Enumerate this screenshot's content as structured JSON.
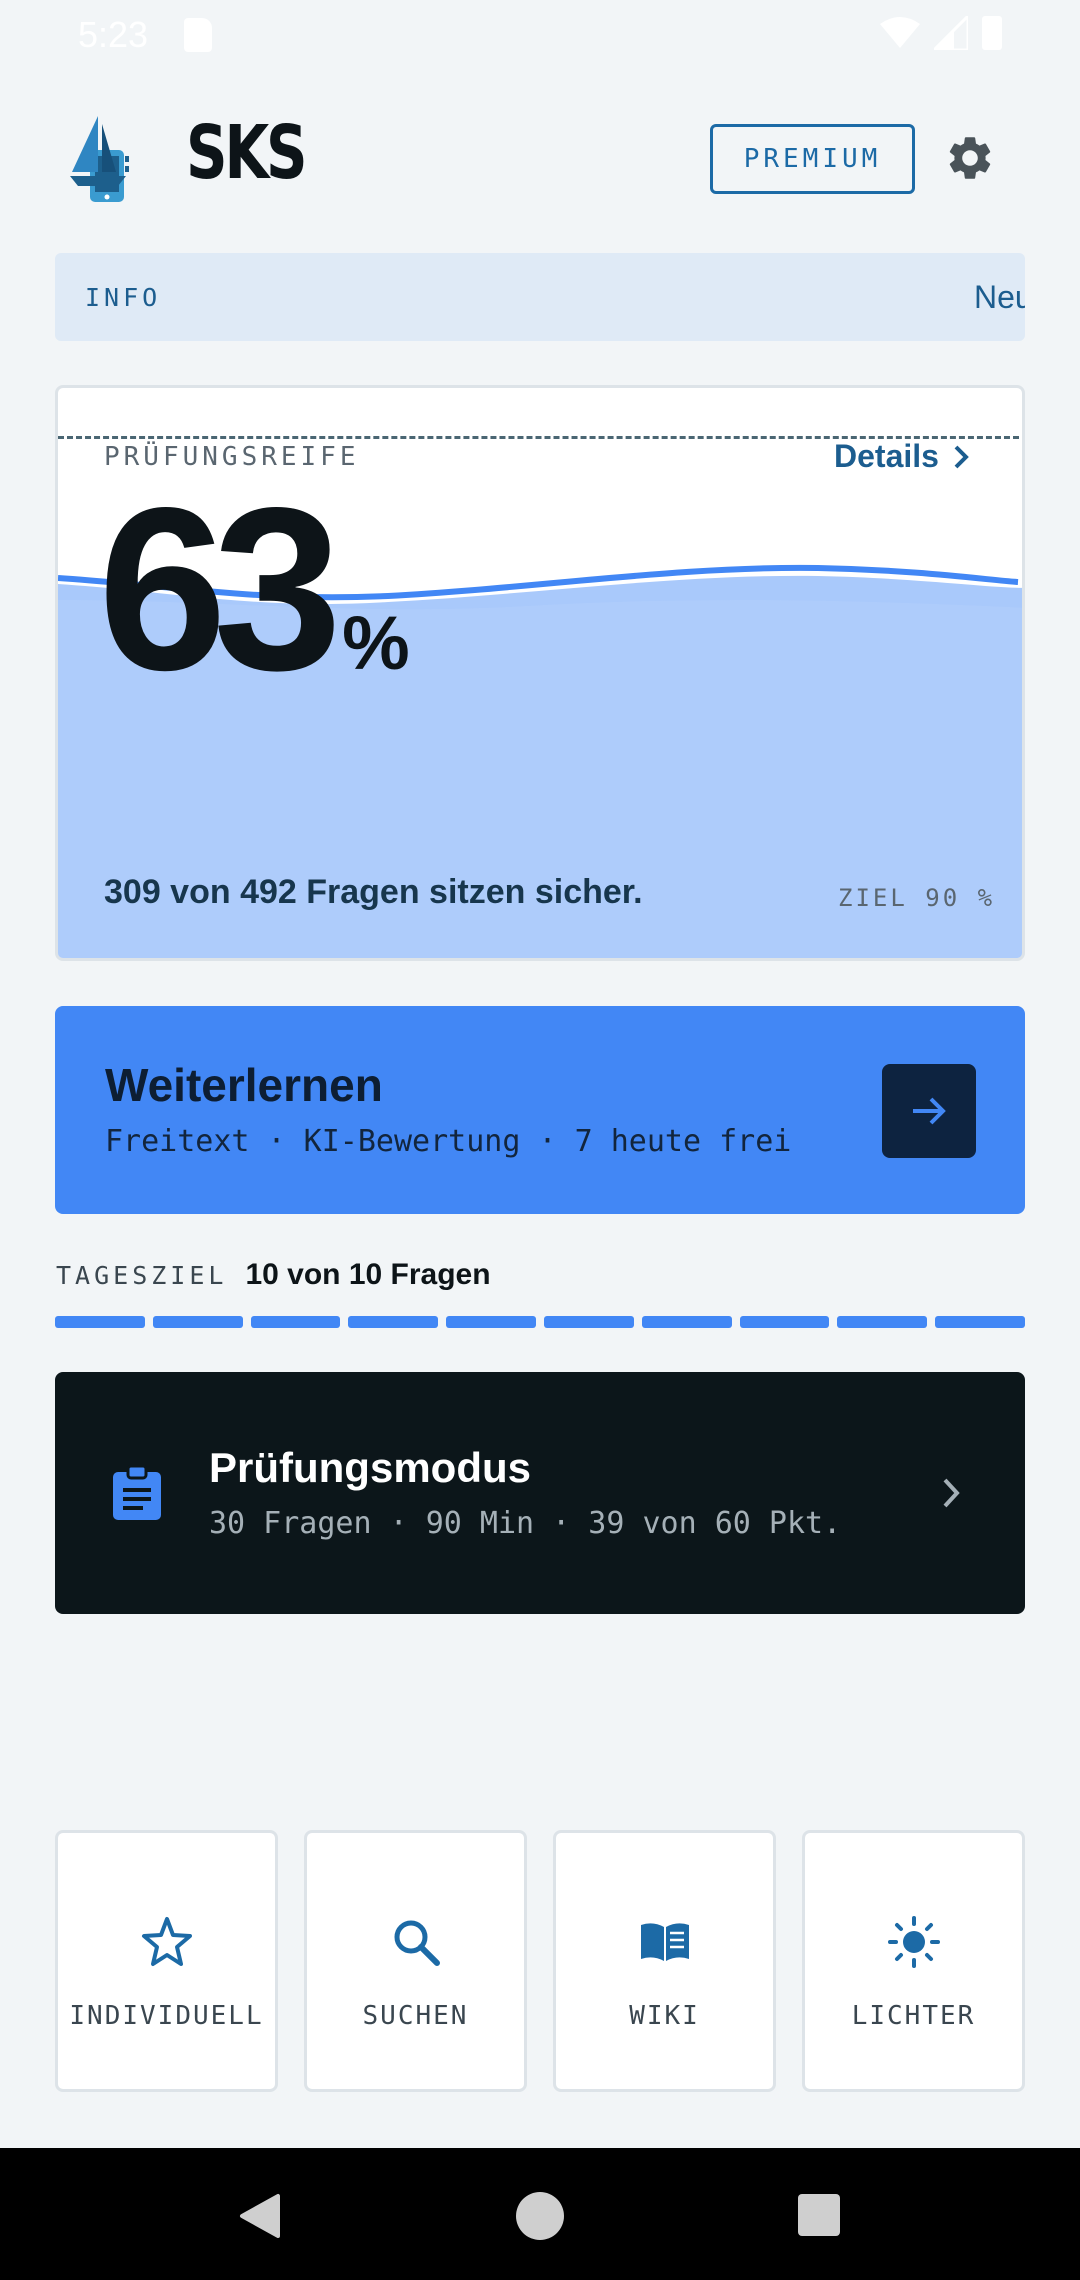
{
  "status_bar": {
    "time": "5:23"
  },
  "header": {
    "title": "SKS",
    "premium_label": "PREMIUM"
  },
  "info": {
    "label": "INFO",
    "ticker": "Neu"
  },
  "readiness": {
    "label": "PRÜFUNGSREIFE",
    "details_label": "Details",
    "percent_value": "63",
    "percent_sign": "%",
    "known_text": "309 von 492 Fragen sitzen sicher.",
    "goal_text": "ZIEL 90 %"
  },
  "continue": {
    "title": "Weiterlernen",
    "subtitle": "Freitext · KI-Bewertung · 7 heute frei"
  },
  "daily_goal": {
    "label": "TAGESZIEL",
    "value": "10 von 10 Fragen",
    "done": 10,
    "total": 10
  },
  "exam": {
    "title": "Prüfungsmodus",
    "subtitle": "30 Fragen · 90 Min · 39 von 60 Pkt."
  },
  "tiles": [
    {
      "label": "INDIVIDUELL",
      "icon": "star-icon"
    },
    {
      "label": "SUCHEN",
      "icon": "search-icon"
    },
    {
      "label": "WIKI",
      "icon": "book-icon"
    },
    {
      "label": "LICHTER",
      "icon": "sun-icon"
    }
  ],
  "colors": {
    "accent": "#4287f5",
    "brand_blue": "#1c6aa6",
    "dark_card": "#0c161a",
    "wave_fill": "#a9c9fb"
  }
}
